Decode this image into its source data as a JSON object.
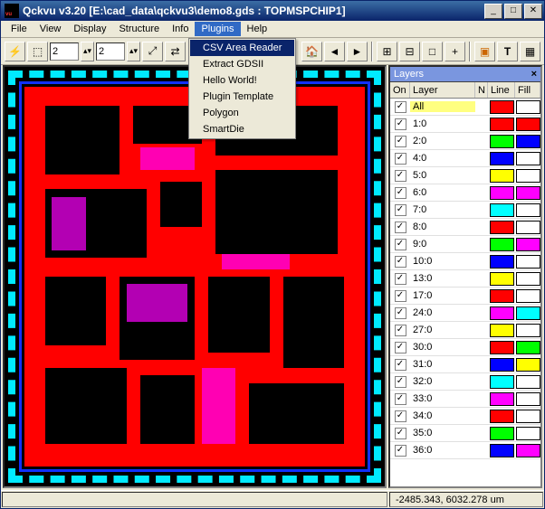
{
  "title": "Qckvu v3.20  [E:\\cad_data\\qckvu3\\demo8.gds : TOPMSPCHIP1]",
  "menu": {
    "items": [
      "File",
      "View",
      "Display",
      "Structure",
      "Info",
      "Plugins",
      "Help"
    ],
    "openIndex": 5
  },
  "toolbar": {
    "lightning": "⚡",
    "spin1": "2",
    "spin2": "2",
    "zoomFit": "⤢",
    "arrows": "⇄"
  },
  "dropdown": {
    "items": [
      "CSV Area Reader",
      "Extract GDSII",
      "Hello World!",
      "Plugin Template",
      "Polygon",
      "SmartDie"
    ],
    "highlight": 0
  },
  "layersPanel": {
    "title": "Layers",
    "headers": {
      "on": "On",
      "layer": "Layer",
      "n": "N",
      "line": "Line",
      "fill": "Fill"
    },
    "allLabel": "All",
    "rows": [
      {
        "name": "1:0",
        "line": "#ff0000",
        "fill": "#ff0000"
      },
      {
        "name": "2:0",
        "line": "#00ff00",
        "fill": "#0000ff"
      },
      {
        "name": "4:0",
        "line": "#0000ff",
        "fill": "#ffffff"
      },
      {
        "name": "5:0",
        "line": "#ffff00",
        "fill": "#ffffff"
      },
      {
        "name": "6:0",
        "line": "#ff00ff",
        "fill": "#ff00ff"
      },
      {
        "name": "7:0",
        "line": "#00ffff",
        "fill": "#ffffff"
      },
      {
        "name": "8:0",
        "line": "#ff0000",
        "fill": "#ffffff"
      },
      {
        "name": "9:0",
        "line": "#00ff00",
        "fill": "#ff00ff"
      },
      {
        "name": "10:0",
        "line": "#0000ff",
        "fill": "#ffffff"
      },
      {
        "name": "13:0",
        "line": "#ffff00",
        "fill": "#ffffff"
      },
      {
        "name": "17:0",
        "line": "#ff0000",
        "fill": "#ffffff"
      },
      {
        "name": "24:0",
        "line": "#ff00ff",
        "fill": "#00ffff"
      },
      {
        "name": "27:0",
        "line": "#ffff00",
        "fill": "#ffffff"
      },
      {
        "name": "30:0",
        "line": "#ff0000",
        "fill": "#00ff00"
      },
      {
        "name": "31:0",
        "line": "#0000ff",
        "fill": "#ffff00"
      },
      {
        "name": "32:0",
        "line": "#00ffff",
        "fill": "#ffffff"
      },
      {
        "name": "33:0",
        "line": "#ff00ff",
        "fill": "#ffffff"
      },
      {
        "name": "34:0",
        "line": "#ff0000",
        "fill": "#ffffff"
      },
      {
        "name": "35:0",
        "line": "#00ff00",
        "fill": "#ffffff"
      },
      {
        "name": "36:0",
        "line": "#0000ff",
        "fill": "#ff00ff"
      }
    ]
  },
  "status": {
    "coords": "-2485.343, 6032.278 um"
  }
}
